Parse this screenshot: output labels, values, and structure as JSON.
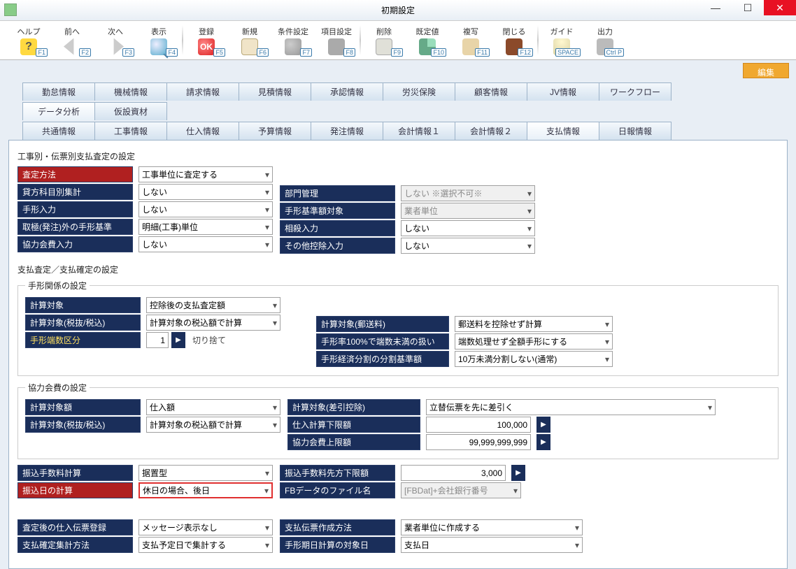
{
  "window": {
    "title": "初期設定"
  },
  "toolbar": {
    "help": {
      "label": "ヘルプ",
      "fkey": "F1"
    },
    "prev": {
      "label": "前へ",
      "fkey": "F2"
    },
    "next": {
      "label": "次へ",
      "fkey": "F3"
    },
    "display": {
      "label": "表示",
      "fkey": "F4"
    },
    "register": {
      "label": "登録",
      "fkey": "F5"
    },
    "new": {
      "label": "新規",
      "fkey": "F6"
    },
    "cond": {
      "label": "条件設定",
      "fkey": "F7"
    },
    "item": {
      "label": "項目設定",
      "fkey": "F8"
    },
    "delete": {
      "label": "削除",
      "fkey": "F9"
    },
    "default": {
      "label": "既定値",
      "fkey": "F10"
    },
    "copy": {
      "label": "複写",
      "fkey": "F11"
    },
    "close": {
      "label": "閉じる",
      "fkey": "F12"
    },
    "guide": {
      "label": "ガイド",
      "fkey": "SPACE"
    },
    "output": {
      "label": "出力",
      "fkey": "Ctrl P"
    }
  },
  "editBtn": "編集",
  "tabsTop": [
    "勤怠情報",
    "機械情報",
    "請求情報",
    "見積情報",
    "承認情報",
    "労災保険",
    "顧客情報",
    "JV情報",
    "ワークフロー"
  ],
  "tabsMid": [
    "データ分析",
    "仮設資材"
  ],
  "tabsMain": [
    "共通情報",
    "工事情報",
    "仕入情報",
    "予算情報",
    "発注情報",
    "会計情報１",
    "会計情報２",
    "支払情報",
    "日報情報"
  ],
  "activeMid": "データ分析",
  "activeMain": "支払情報",
  "sec1": {
    "title": "工事別・伝票別支払査定の設定",
    "rows": {
      "r1": {
        "lbl": "査定方法",
        "val": "工事単位に査定する"
      },
      "r2": {
        "lbl": "貸方科目別集計",
        "val": "しない"
      },
      "r3": {
        "lbl": "手形入力",
        "val": "しない"
      },
      "r4": {
        "lbl": "取極(発注)外の手形基準",
        "val": "明細(工事)単位"
      },
      "r5": {
        "lbl": "協力会費入力",
        "val": "しない"
      },
      "r2b": {
        "lbl": "部門管理",
        "val": "しない ※選択不可※"
      },
      "r3b": {
        "lbl": "手形基準額対象",
        "val": "業者単位"
      },
      "r4b": {
        "lbl": "相殺入力",
        "val": "しない"
      },
      "r5b": {
        "lbl": "その他控除入力",
        "val": "しない"
      }
    }
  },
  "sec2": {
    "title": "支払査定／支払確定の設定",
    "fs1": {
      "legend": "手形関係の設定",
      "r1": {
        "lbl": "計算対象",
        "val": "控除後の支払査定額"
      },
      "r2": {
        "lbl": "計算対象(税抜/税込)",
        "val": "計算対象の税込額で計算"
      },
      "r3": {
        "lbl": "手形端数区分",
        "num": "1",
        "static": "切り捨て"
      },
      "r2b": {
        "lbl": "計算対象(郵送料)",
        "val": "郵送料を控除せず計算"
      },
      "r3b": {
        "lbl": "手形率100%で端数未満の扱い",
        "val": "端数処理せず全額手形にする"
      },
      "r4b": {
        "lbl": "手形経済分割の分割基準額",
        "val": "10万未満分割しない(通常)"
      }
    },
    "fs2": {
      "legend": "協力会費の設定",
      "r1": {
        "lbl": "計算対象額",
        "val": "仕入額"
      },
      "r2": {
        "lbl": "計算対象(税抜/税込)",
        "val": "計算対象の税込額で計算"
      },
      "r1b": {
        "lbl": "計算対象(差引控除)",
        "val": "立替伝票を先に差引く"
      },
      "r2b": {
        "lbl": "仕入計算下限額",
        "val": "100,000"
      },
      "r3b": {
        "lbl": "協力会費上限額",
        "val": "99,999,999,999"
      }
    },
    "r_fee": {
      "lbl": "振込手数料計算",
      "val": "据置型"
    },
    "r_feeb": {
      "lbl": "振込手数料先方下限額",
      "val": "3,000"
    },
    "r_date": {
      "lbl": "振込日の計算",
      "val": "休日の場合、後日"
    },
    "r_dateb": {
      "lbl": "FBデータのファイル名",
      "val": "[FBDat]+会社銀行番号"
    },
    "r_after": {
      "lbl": "査定後の仕入伝票登録",
      "val": "メッセージ表示なし"
    },
    "r_afterb": {
      "lbl": "支払伝票作成方法",
      "val": "業者単位に作成する"
    },
    "r_fix": {
      "lbl": "支払確定集計方法",
      "val": "支払予定日で集計する"
    },
    "r_fixb": {
      "lbl": "手形期日計算の対象日",
      "val": "支払日"
    }
  }
}
